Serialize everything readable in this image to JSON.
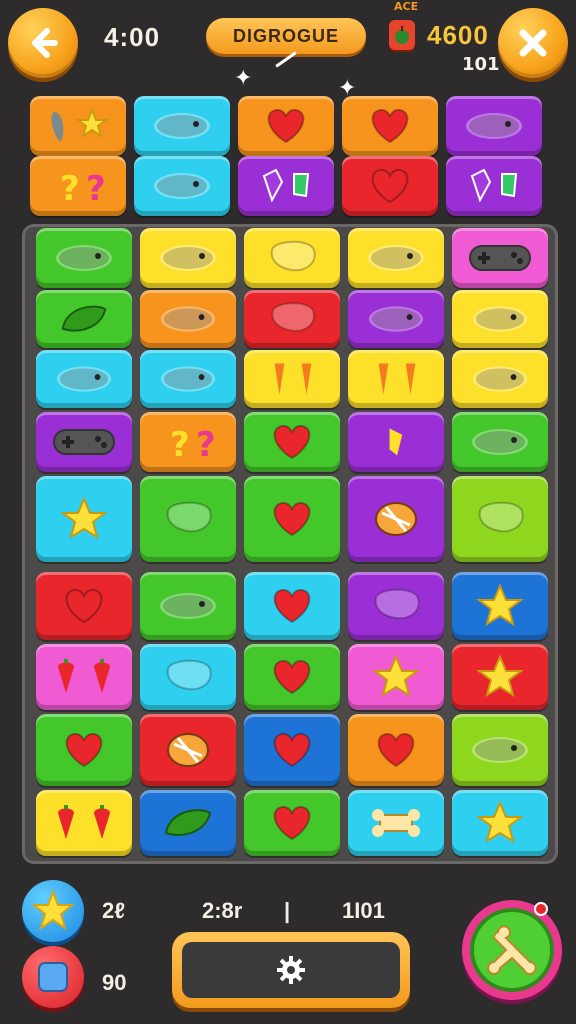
{
  "header": {
    "back_icon": "back-arrow-icon",
    "timer": "4:00",
    "title": "DIGROGUE",
    "level_tag": "ACE",
    "score": "4600",
    "moves": "101",
    "close_icon": "close-icon"
  },
  "colors": {
    "orange": "#f7941d",
    "cyan": "#2fd0ef",
    "purple": "#9b2fd6",
    "green": "#43c72a",
    "yellow": "#fde02a",
    "red": "#e8262c",
    "pink": "#f05ad3",
    "lime": "#8fd61f",
    "blue": "#1e74d6"
  },
  "top_rows": [
    [
      {
        "bg": "orange",
        "icon": "pepper-star-icon"
      },
      {
        "bg": "cyan",
        "icon": "jelly-bean-icon"
      },
      {
        "bg": "orange",
        "icon": "heart-icon"
      },
      {
        "bg": "orange",
        "icon": "heart-icon"
      },
      {
        "bg": "purple",
        "icon": "jelly-bean-icon"
      }
    ],
    [
      {
        "bg": "orange",
        "icon": "question-icon"
      },
      {
        "bg": "cyan",
        "icon": "jelly-bean-icon"
      },
      {
        "bg": "purple",
        "icon": "gem-icon"
      },
      {
        "bg": "red",
        "icon": "heart-icon"
      },
      {
        "bg": "purple",
        "icon": "gem-icon"
      }
    ]
  ],
  "grid": [
    [
      {
        "bg": "green",
        "icon": "jelly-bean-icon"
      },
      {
        "bg": "yellow",
        "icon": "jelly-bean-icon"
      },
      {
        "bg": "yellow",
        "icon": "blob-icon"
      },
      {
        "bg": "yellow",
        "icon": "jelly-bean-icon"
      },
      {
        "bg": "pink",
        "icon": "gamepad-icon"
      }
    ],
    [
      {
        "bg": "green",
        "icon": "leaf-icon"
      },
      {
        "bg": "orange",
        "icon": "jelly-bean-icon"
      },
      {
        "bg": "red",
        "icon": "blob-icon"
      },
      {
        "bg": "purple",
        "icon": "jelly-bean-icon"
      },
      {
        "bg": "yellow",
        "icon": "jelly-bean-icon"
      }
    ],
    [
      {
        "bg": "cyan",
        "icon": "jelly-bean-icon"
      },
      {
        "bg": "cyan",
        "icon": "jelly-bean-icon"
      },
      {
        "bg": "yellow",
        "icon": "carrot-icon"
      },
      {
        "bg": "yellow",
        "icon": "carrot-icon"
      },
      {
        "bg": "yellow",
        "icon": "jelly-bean-icon"
      }
    ],
    [
      {
        "bg": "purple",
        "icon": "gamepad-icon"
      },
      {
        "bg": "orange",
        "icon": "question-icon"
      },
      {
        "bg": "green",
        "icon": "heart-icon"
      },
      {
        "bg": "purple",
        "icon": "candy-icon"
      },
      {
        "bg": "green",
        "icon": "jelly-bean-icon"
      }
    ],
    [
      {
        "bg": "cyan",
        "icon": "star-icon"
      },
      {
        "bg": "green",
        "icon": "blob-icon"
      },
      {
        "bg": "green",
        "icon": "heart-icon"
      },
      {
        "bg": "purple",
        "icon": "shell-icon"
      },
      {
        "bg": "lime",
        "icon": "blob-icon"
      }
    ],
    [
      {
        "bg": "red",
        "icon": "heart-icon"
      },
      {
        "bg": "green",
        "icon": "jelly-bean-icon"
      },
      {
        "bg": "cyan",
        "icon": "heart-icon"
      },
      {
        "bg": "purple",
        "icon": "blob-icon"
      },
      {
        "bg": "blue",
        "icon": "star-icon"
      }
    ],
    [
      {
        "bg": "pink",
        "icon": "strawberry-icon"
      },
      {
        "bg": "cyan",
        "icon": "blob-icon"
      },
      {
        "bg": "green",
        "icon": "heart-icon"
      },
      {
        "bg": "pink",
        "icon": "star-icon"
      },
      {
        "bg": "red",
        "icon": "star-icon"
      }
    ],
    [
      {
        "bg": "green",
        "icon": "heart-icon"
      },
      {
        "bg": "red",
        "icon": "shell-icon"
      },
      {
        "bg": "blue",
        "icon": "heart-icon"
      },
      {
        "bg": "orange",
        "icon": "heart-icon"
      },
      {
        "bg": "lime",
        "icon": "jelly-bean-icon"
      }
    ],
    [
      {
        "bg": "yellow",
        "icon": "strawberry-icon"
      },
      {
        "bg": "blue",
        "icon": "leaf-icon"
      },
      {
        "bg": "green",
        "icon": "heart-icon"
      },
      {
        "bg": "cyan",
        "icon": "bone-icon"
      },
      {
        "bg": "cyan",
        "icon": "star-icon"
      }
    ]
  ],
  "footer": {
    "star_count": "2ℓ",
    "block_count": "90",
    "time_label": "2:8r",
    "divider": "|",
    "score_label": "1Ι01",
    "settings_icon": "gear-icon",
    "boost_icon": "bone-icon"
  }
}
